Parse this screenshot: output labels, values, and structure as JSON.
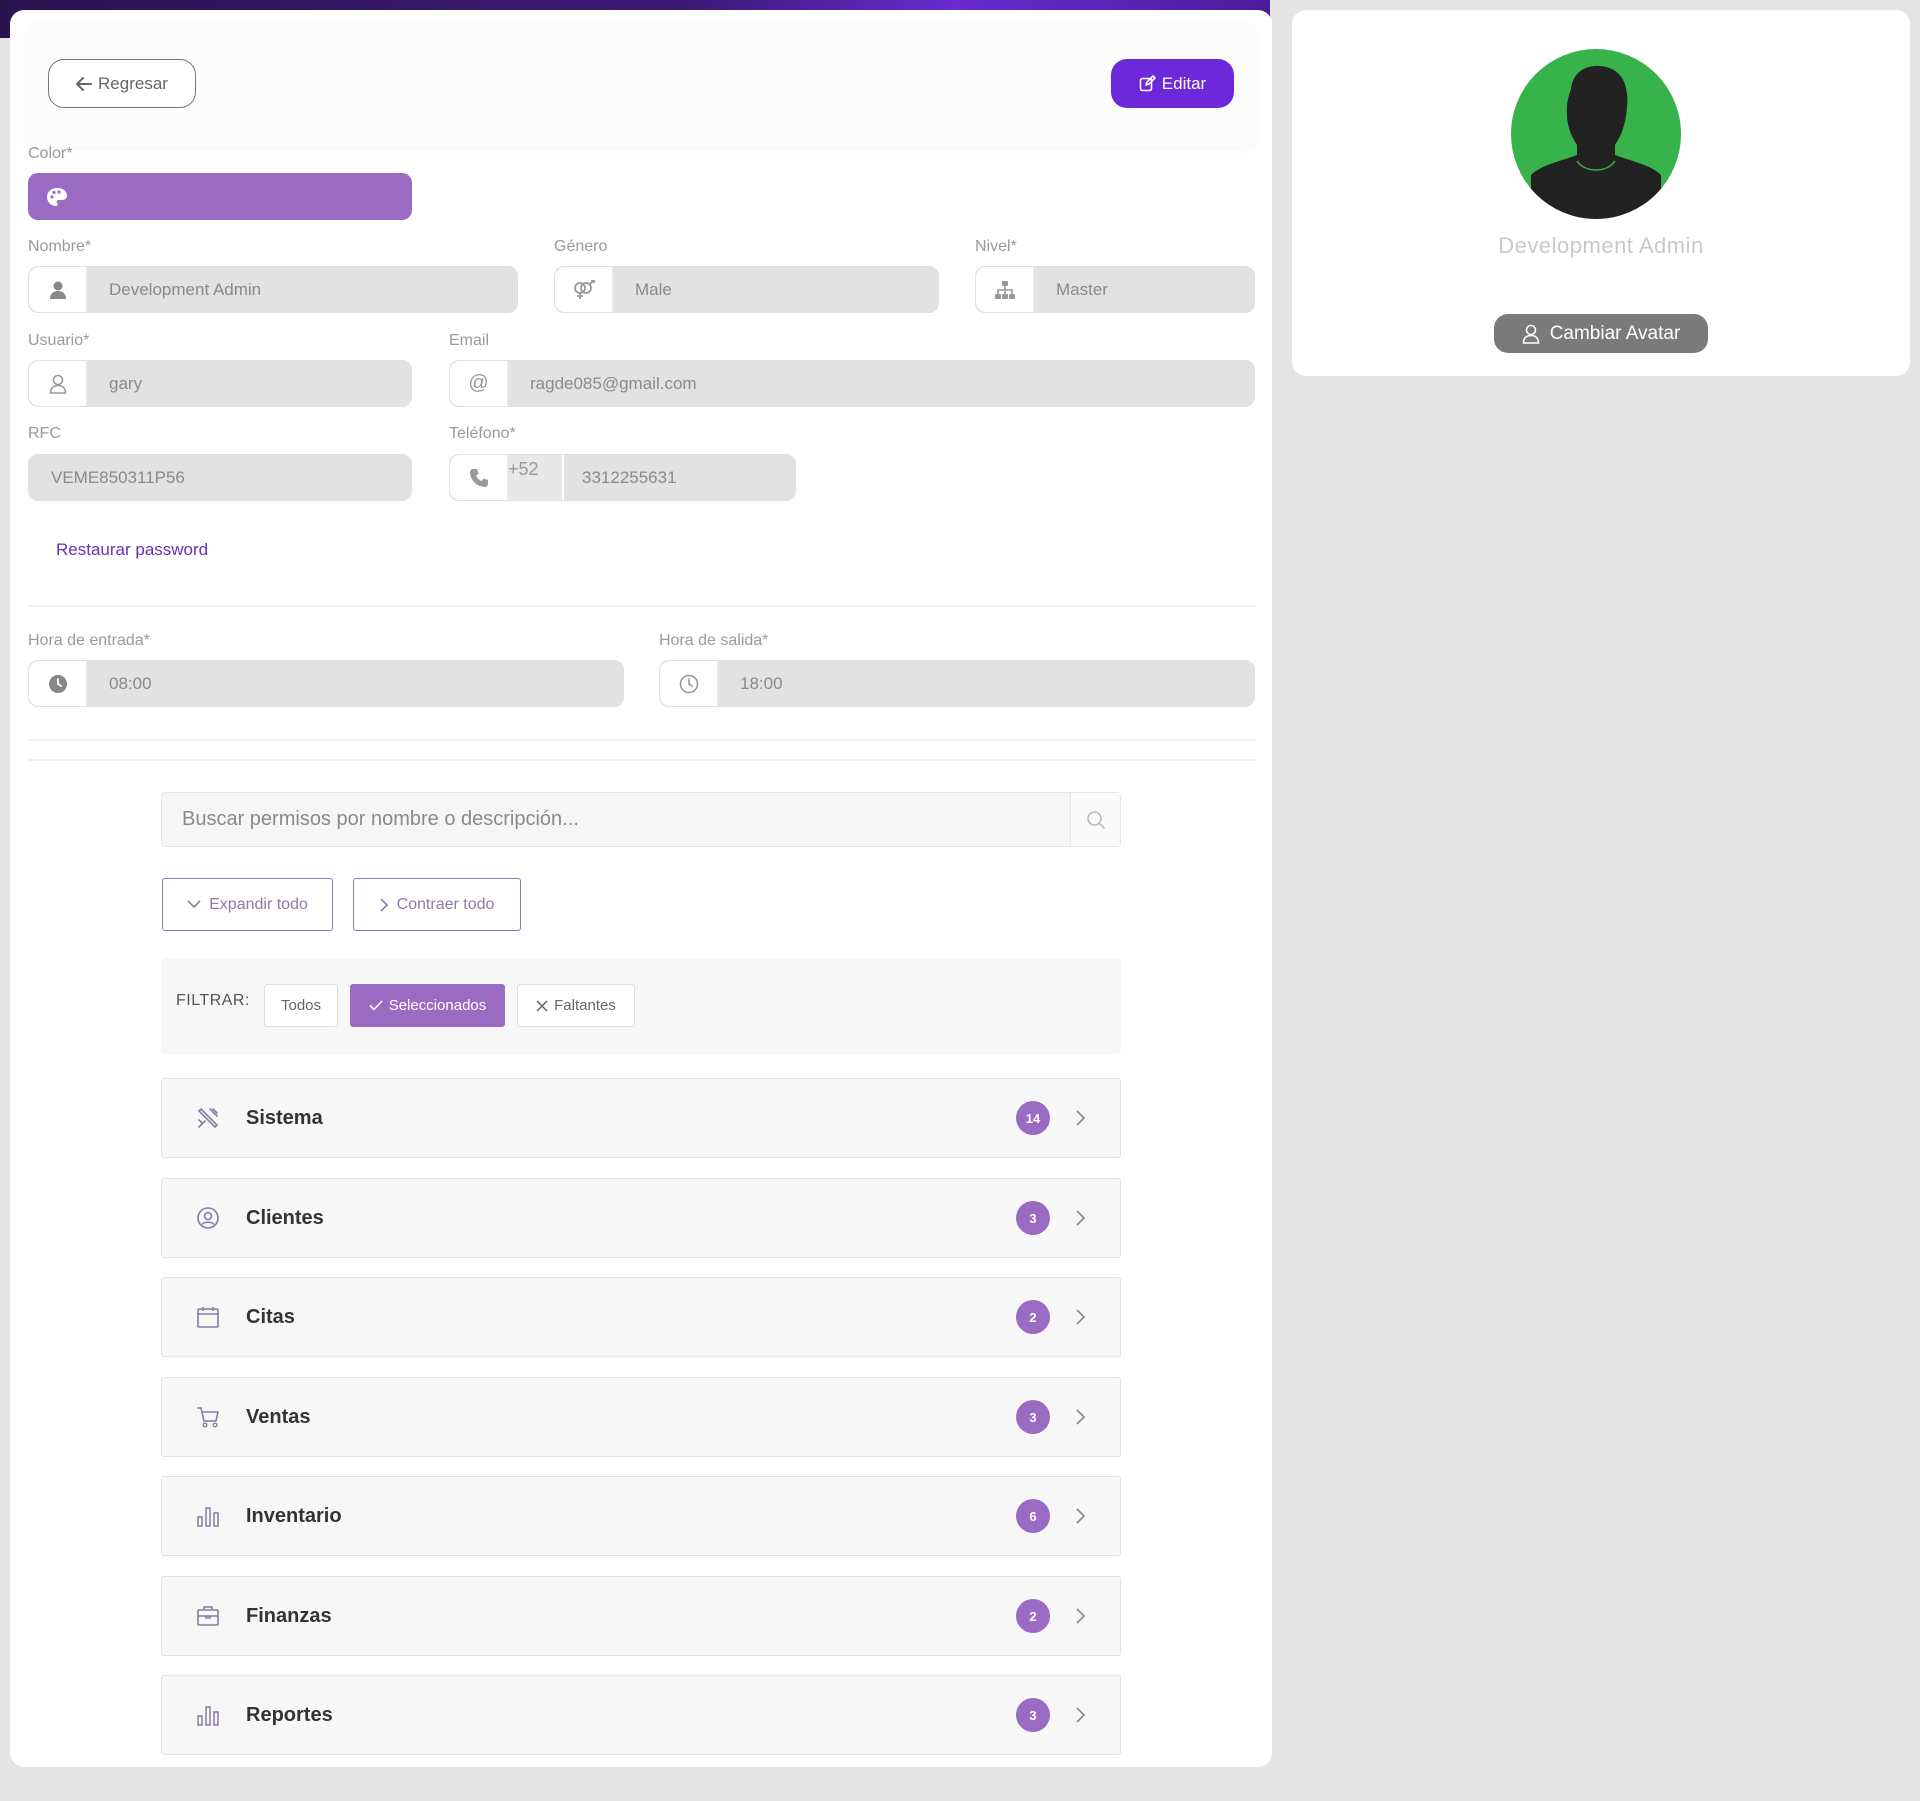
{
  "header": {
    "back_label": "Regresar",
    "edit_label": "Editar"
  },
  "form": {
    "color_label": "Color*",
    "color_value": "#9b6bc3",
    "nombre_label": "Nombre*",
    "nombre_value": "Development Admin",
    "genero_label": "Género",
    "genero_value": "Male",
    "nivel_label": "Nivel*",
    "nivel_value": "Master",
    "usuario_label": "Usuario*",
    "usuario_value": "gary",
    "email_label": "Email",
    "email_value": "ragde085@gmail.com",
    "rfc_label": "RFC",
    "rfc_value": "VEME850311P56",
    "telefono_label": "Teléfono*",
    "telefono_prefix": "+52",
    "telefono_value": "3312255631",
    "reset_password_label": "Restaurar password",
    "hora_entrada_label": "Hora de entrada*",
    "hora_entrada_value": "08:00",
    "hora_salida_label": "Hora de salida*",
    "hora_salida_value": "18:00"
  },
  "permissions": {
    "search_placeholder": "Buscar permisos por nombre o descripción...",
    "expand_label": "Expandir todo",
    "collapse_label": "Contraer todo",
    "filter_label": "FILTRAR:",
    "filter_all": "Todos",
    "filter_selected": "Seleccionados",
    "filter_missing": "Faltantes",
    "groups": [
      {
        "name": "Sistema",
        "count": "14",
        "icon": "tools-icon"
      },
      {
        "name": "Clientes",
        "count": "3",
        "icon": "user-circle-icon"
      },
      {
        "name": "Citas",
        "count": "2",
        "icon": "calendar-icon"
      },
      {
        "name": "Ventas",
        "count": "3",
        "icon": "cart-icon"
      },
      {
        "name": "Inventario",
        "count": "6",
        "icon": "bar-chart-icon"
      },
      {
        "name": "Finanzas",
        "count": "2",
        "icon": "briefcase-icon"
      },
      {
        "name": "Reportes",
        "count": "3",
        "icon": "bar-chart-icon"
      }
    ]
  },
  "profile": {
    "name": "Development Admin",
    "change_avatar_label": "Cambiar Avatar"
  },
  "colors": {
    "accent": "#6d28d9",
    "badge": "#9b6bc3",
    "avatar_bg": "#38b24a"
  }
}
